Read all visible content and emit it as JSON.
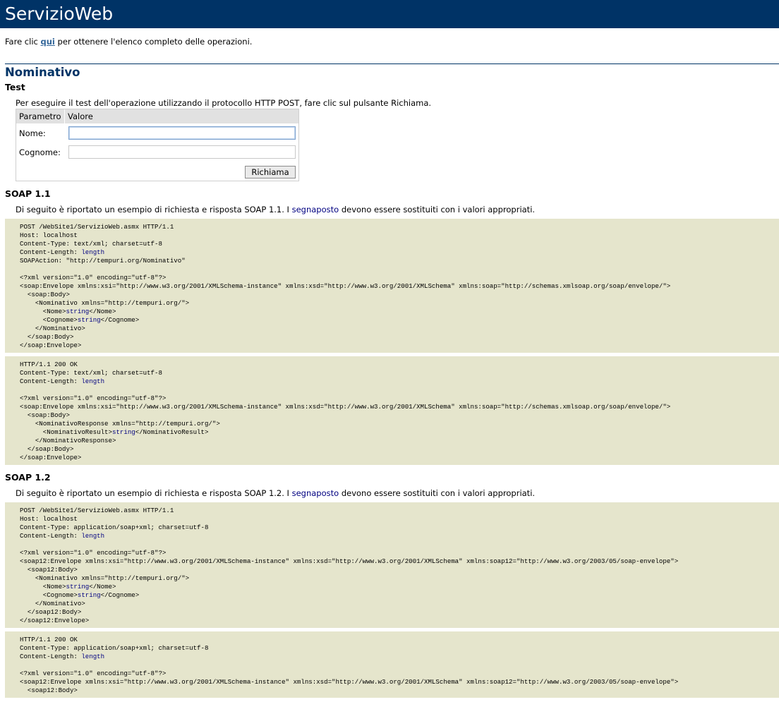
{
  "banner": {
    "title": "ServizioWeb"
  },
  "intro": {
    "before": "Fare clic ",
    "link": "qui",
    "after": " per ottenere l'elenco completo delle operazioni."
  },
  "operation": {
    "name": "Nominativo"
  },
  "test": {
    "heading": "Test",
    "description": "Per eseguire il test dell'operazione utilizzando il protocollo HTTP POST, fare clic sul pulsante Richiama.",
    "col_param": "Parametro",
    "col_value": "Valore",
    "params": [
      {
        "label": "Nome:",
        "value": ""
      },
      {
        "label": "Cognome:",
        "value": ""
      }
    ],
    "invoke_label": "Richiama"
  },
  "soap11": {
    "heading": "SOAP 1.1",
    "desc_before": "Di seguito è riportato un esempio di richiesta e risposta SOAP 1.1. I ",
    "placeholder_word": "segnaposto",
    "desc_after": " devono essere sostituiti con i valori appropriati.",
    "request": [
      [
        [
          "POST /WebSite1/ServizioWeb.asmx HTTP/1.1",
          0
        ]
      ],
      [
        [
          "Host: localhost",
          0
        ]
      ],
      [
        [
          "Content-Type: text/xml; charset=utf-8",
          0
        ]
      ],
      [
        [
          "Content-Length: ",
          0
        ],
        [
          "length",
          1
        ]
      ],
      [
        [
          "SOAPAction: \"http://tempuri.org/Nominativo\"",
          0
        ]
      ],
      [],
      [
        [
          "<?xml version=\"1.0\" encoding=\"utf-8\"?>",
          0
        ]
      ],
      [
        [
          "<soap:Envelope xmlns:xsi=\"http://www.w3.org/2001/XMLSchema-instance\" xmlns:xsd=\"http://www.w3.org/2001/XMLSchema\" xmlns:soap=\"http://schemas.xmlsoap.org/soap/envelope/\">",
          0
        ]
      ],
      [
        [
          "  <soap:Body>",
          0
        ]
      ],
      [
        [
          "    <Nominativo xmlns=\"http://tempuri.org/\">",
          0
        ]
      ],
      [
        [
          "      <Nome>",
          0
        ],
        [
          "string",
          1
        ],
        [
          "</Nome>",
          0
        ]
      ],
      [
        [
          "      <Cognome>",
          0
        ],
        [
          "string",
          1
        ],
        [
          "</Cognome>",
          0
        ]
      ],
      [
        [
          "    </Nominativo>",
          0
        ]
      ],
      [
        [
          "  </soap:Body>",
          0
        ]
      ],
      [
        [
          "</soap:Envelope>",
          0
        ]
      ]
    ],
    "response": [
      [
        [
          "HTTP/1.1 200 OK",
          0
        ]
      ],
      [
        [
          "Content-Type: text/xml; charset=utf-8",
          0
        ]
      ],
      [
        [
          "Content-Length: ",
          0
        ],
        [
          "length",
          1
        ]
      ],
      [],
      [
        [
          "<?xml version=\"1.0\" encoding=\"utf-8\"?>",
          0
        ]
      ],
      [
        [
          "<soap:Envelope xmlns:xsi=\"http://www.w3.org/2001/XMLSchema-instance\" xmlns:xsd=\"http://www.w3.org/2001/XMLSchema\" xmlns:soap=\"http://schemas.xmlsoap.org/soap/envelope/\">",
          0
        ]
      ],
      [
        [
          "  <soap:Body>",
          0
        ]
      ],
      [
        [
          "    <NominativoResponse xmlns=\"http://tempuri.org/\">",
          0
        ]
      ],
      [
        [
          "      <NominativoResult>",
          0
        ],
        [
          "string",
          1
        ],
        [
          "</NominativoResult>",
          0
        ]
      ],
      [
        [
          "    </NominativoResponse>",
          0
        ]
      ],
      [
        [
          "  </soap:Body>",
          0
        ]
      ],
      [
        [
          "</soap:Envelope>",
          0
        ]
      ]
    ]
  },
  "soap12": {
    "heading": "SOAP 1.2",
    "desc_before": "Di seguito è riportato un esempio di richiesta e risposta SOAP 1.2. I ",
    "placeholder_word": "segnaposto",
    "desc_after": " devono essere sostituiti con i valori appropriati.",
    "request": [
      [
        [
          "POST /WebSite1/ServizioWeb.asmx HTTP/1.1",
          0
        ]
      ],
      [
        [
          "Host: localhost",
          0
        ]
      ],
      [
        [
          "Content-Type: application/soap+xml; charset=utf-8",
          0
        ]
      ],
      [
        [
          "Content-Length: ",
          0
        ],
        [
          "length",
          1
        ]
      ],
      [],
      [
        [
          "<?xml version=\"1.0\" encoding=\"utf-8\"?>",
          0
        ]
      ],
      [
        [
          "<soap12:Envelope xmlns:xsi=\"http://www.w3.org/2001/XMLSchema-instance\" xmlns:xsd=\"http://www.w3.org/2001/XMLSchema\" xmlns:soap12=\"http://www.w3.org/2003/05/soap-envelope\">",
          0
        ]
      ],
      [
        [
          "  <soap12:Body>",
          0
        ]
      ],
      [
        [
          "    <Nominativo xmlns=\"http://tempuri.org/\">",
          0
        ]
      ],
      [
        [
          "      <Nome>",
          0
        ],
        [
          "string",
          1
        ],
        [
          "</Nome>",
          0
        ]
      ],
      [
        [
          "      <Cognome>",
          0
        ],
        [
          "string",
          1
        ],
        [
          "</Cognome>",
          0
        ]
      ],
      [
        [
          "    </Nominativo>",
          0
        ]
      ],
      [
        [
          "  </soap12:Body>",
          0
        ]
      ],
      [
        [
          "</soap12:Envelope>",
          0
        ]
      ]
    ],
    "response": [
      [
        [
          "HTTP/1.1 200 OK",
          0
        ]
      ],
      [
        [
          "Content-Type: application/soap+xml; charset=utf-8",
          0
        ]
      ],
      [
        [
          "Content-Length: ",
          0
        ],
        [
          "length",
          1
        ]
      ],
      [],
      [
        [
          "<?xml version=\"1.0\" encoding=\"utf-8\"?>",
          0
        ]
      ],
      [
        [
          "<soap12:Envelope xmlns:xsi=\"http://www.w3.org/2001/XMLSchema-instance\" xmlns:xsd=\"http://www.w3.org/2001/XMLSchema\" xmlns:soap12=\"http://www.w3.org/2003/05/soap-envelope\">",
          0
        ]
      ],
      [
        [
          "  <soap12:Body>",
          0
        ]
      ]
    ]
  },
  "colors": {
    "banner": "#003366",
    "code_background": "#e5e5cc",
    "placeholder_text": "#000080",
    "link": "#336699"
  }
}
